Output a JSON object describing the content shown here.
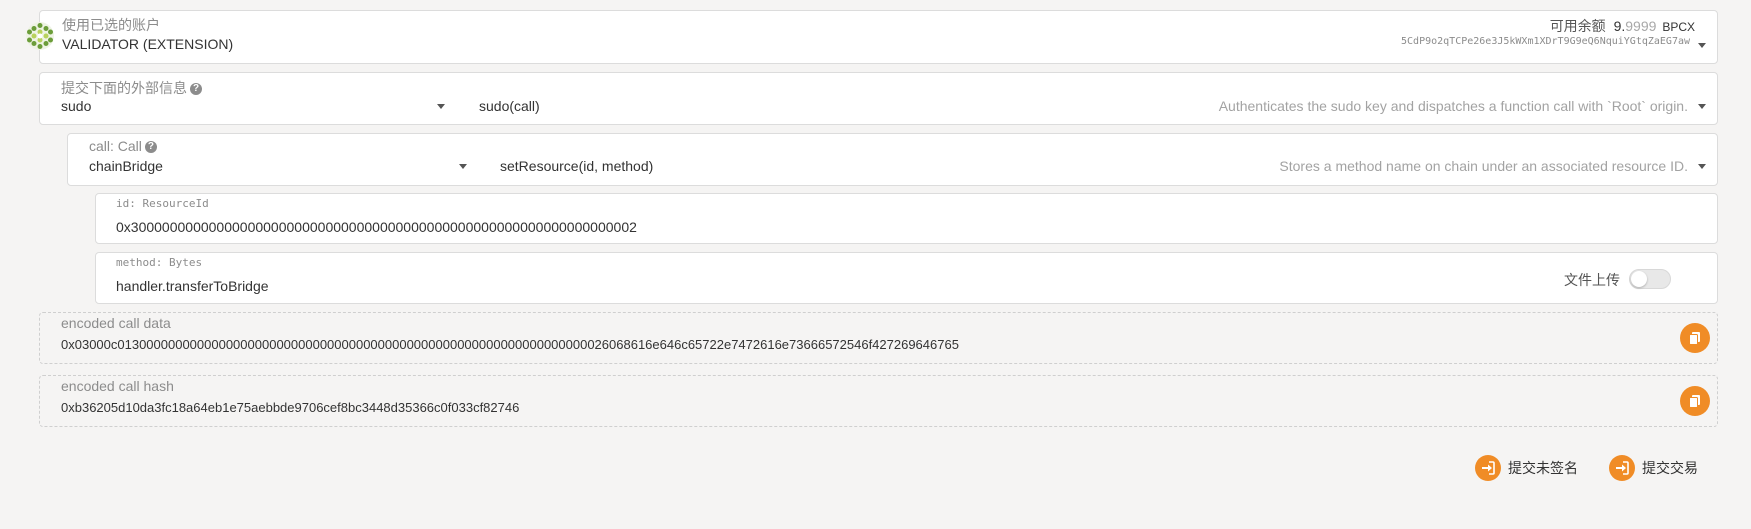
{
  "account": {
    "label": "使用已选的账户",
    "name": "VALIDATOR (EXTENSION)",
    "balance_label": "可用余额",
    "balance_int": "9.",
    "balance_dec": "9999",
    "balance_unit": "BPCX",
    "address": "5CdP9o2qTCPe26e3J5kWXm1XDrT9G9eQ6NquiYGtqZaEG7aw"
  },
  "extrinsic": {
    "label": "提交下面的外部信息",
    "pallet": "sudo",
    "method": "sudo(call)",
    "description": "Authenticates the sudo key and dispatches a function call with `Root` origin."
  },
  "call": {
    "label": "call: Call",
    "pallet": "chainBridge",
    "method": "setResource(id, method)",
    "description": "Stores a method name on chain under an associated resource ID."
  },
  "param_id": {
    "label": "id: ResourceId",
    "value": "0x30000000000000000000000000000000000000000000000000000000000000002"
  },
  "param_method": {
    "label": "method: Bytes",
    "value": "handler.transferToBridge",
    "upload_label": "文件上传"
  },
  "encoded_data": {
    "label": "encoded call data",
    "value": "0x03000c01300000000000000000000000000000000000000000000000000000000000000026068616e646c65722e7472616e73666572546f427269646765"
  },
  "encoded_hash": {
    "label": "encoded call hash",
    "value": "0xb36205d10da3fc18a64eb1e75aebbde9706cef8bc3448d35366c0f033cf82746"
  },
  "actions": {
    "unsigned": "提交未签名",
    "submit": "提交交易"
  },
  "colors": {
    "accent": "#f08c26"
  },
  "icons": [
    "identicon",
    "help-icon",
    "chevron-down-icon",
    "copy-icon",
    "sign-in-icon"
  ]
}
